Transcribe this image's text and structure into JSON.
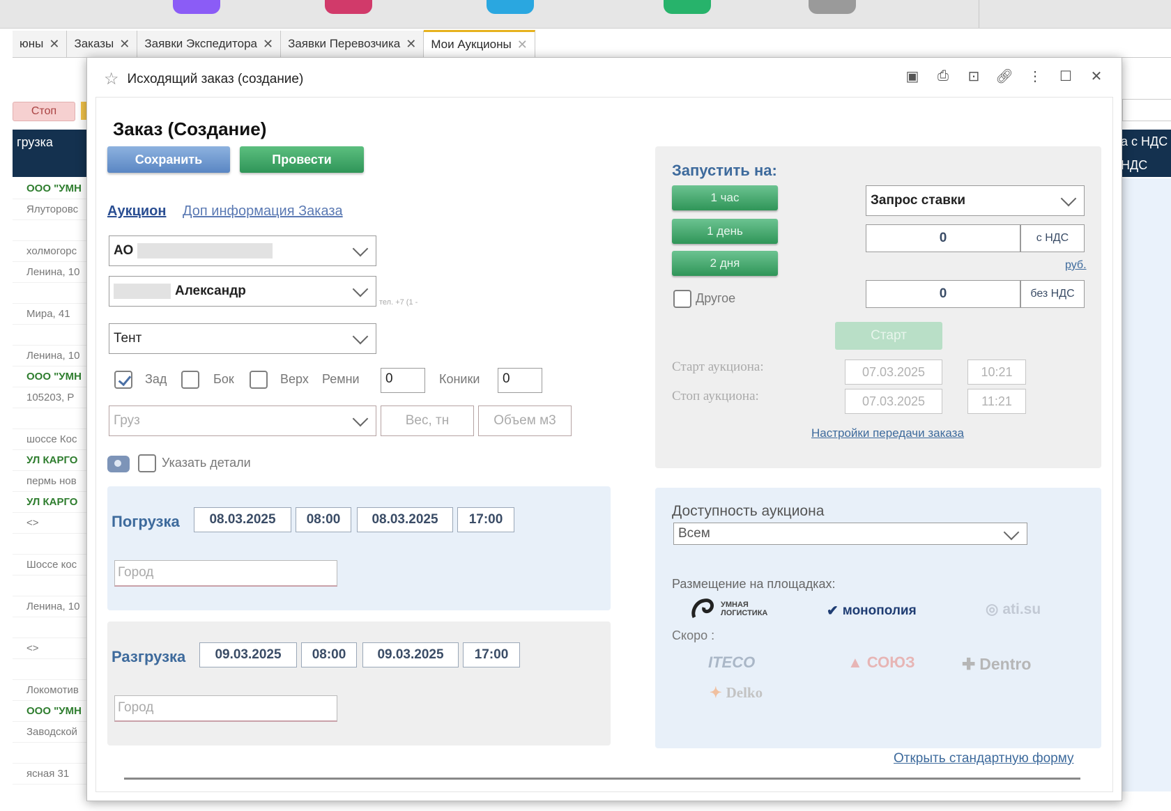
{
  "tabs": [
    {
      "label": "юны"
    },
    {
      "label": "Заказы"
    },
    {
      "label": "Заявки Экспедитора"
    },
    {
      "label": "Заявки Перевозчика"
    },
    {
      "label": "Мои Аукционы"
    }
  ],
  "background": {
    "stop_button": "Стоп",
    "header_col": "грузка",
    "right_header": [
      "а с НДС",
      "НДС"
    ],
    "rows": [
      "ООО \"УМН",
      "Ялуторовс",
      "",
      "холмогорс",
      "Ленина, 10",
      "",
      "Мира, 41",
      "",
      "Ленина, 10",
      "ООО \"УМН",
      "105203, Р",
      "",
      "шоссе Кос",
      "УЛ КАРГО",
      "пермь нов",
      "УЛ КАРГО",
      "<>",
      "",
      "Шоссе кос",
      "",
      "Ленина, 10",
      "",
      "<>",
      "",
      "Локомотив",
      "ООО \"УМН",
      "Заводской",
      "",
      "ясная 31"
    ]
  },
  "dialog": {
    "title": "Исходящий заказ (создание)",
    "form_title": "Заказ (Создание)",
    "save_label": "Сохранить",
    "post_label": "Провести",
    "link_auction": "Аукцион",
    "link_info": "Доп информация Заказа",
    "company_prefix": "АО",
    "contact_name": "Александр",
    "phone_hint": "тел. +7 (1 -",
    "body_type": "Тент",
    "loading": {
      "rear": "Зад",
      "side": "Бок",
      "top": "Верх",
      "belts_label": "Ремни",
      "belts_value": "0",
      "cones_label": "Коники",
      "cones_value": "0"
    },
    "cargo_placeholder": "Груз",
    "weight_placeholder": "Вес, тн",
    "volume_placeholder": "Объем м3",
    "details_label": "Указать детали",
    "pickup": {
      "label": "Погрузка",
      "date_from": "08.03.2025",
      "time_from": "08:00",
      "date_to": "08.03.2025",
      "time_to": "17:00",
      "city_placeholder": "Город"
    },
    "delivery": {
      "label": "Разгрузка",
      "date_from": "09.03.2025",
      "time_from": "08:00",
      "date_to": "09.03.2025",
      "time_to": "17:00",
      "city_placeholder": "Город"
    },
    "launch": {
      "title": "Запустить на:",
      "btn_1h": "1 час",
      "btn_1d": "1 день",
      "btn_2d": "2 дня",
      "other_label": "Другое",
      "rate_type": "Запрос ставки",
      "price_vat": "0",
      "vat_label": "с НДС",
      "currency": "руб.",
      "price_novat": "0",
      "novat_label": "без НДС",
      "start_label": "Старт",
      "start_auction_label": "Старт аукциона:",
      "start_date": "07.03.2025",
      "start_time": "10:21",
      "stop_auction_label": "Стоп аукциона:",
      "stop_date": "07.03.2025",
      "stop_time": "11:21",
      "settings_link": "Настройки передачи заказа"
    },
    "availability": {
      "title": "Доступность аукциона",
      "value": "Всем",
      "platforms_title": "Размещение на площадках:",
      "platforms": [
        "УМНАЯ ЛОГИСТИКА",
        "монополия",
        "ati.su"
      ],
      "soon_title": "Скоро :",
      "soon": [
        "ITECO",
        "СОЮЗ",
        "Dentro",
        "Delko"
      ]
    },
    "open_standard_form": "Открыть стандартную форму"
  }
}
